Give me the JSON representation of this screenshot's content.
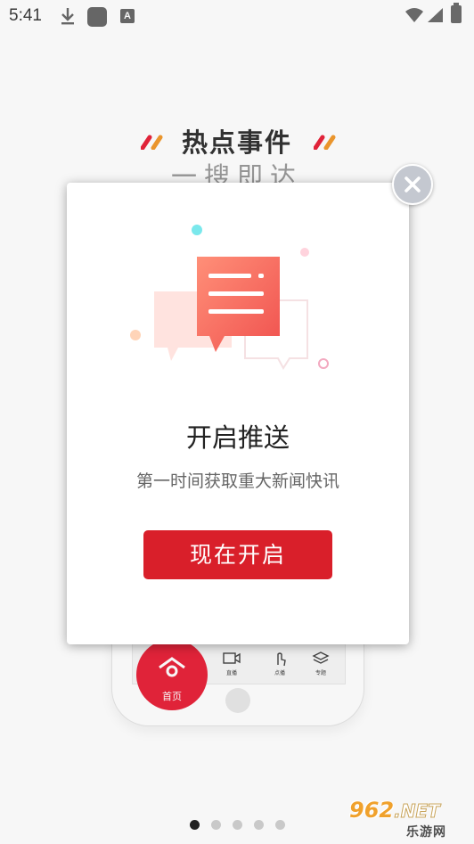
{
  "status_bar": {
    "time": "5:41",
    "icons": [
      "download-icon",
      "app-notification-icon",
      "text-a-icon",
      "wifi-icon",
      "signal-icon",
      "battery-icon"
    ],
    "a_letter": "A"
  },
  "background": {
    "headline": "热点事件",
    "subline": "一搜即达",
    "phone_tabs": {
      "home": "首页",
      "tab2": "直播",
      "tab3": "点播",
      "tab4": "专题"
    }
  },
  "dialog": {
    "title": "开启推送",
    "description": "第一时间获取重大新闻快讯",
    "button_label": "现在开启",
    "close_icon": "close-icon"
  },
  "pager": {
    "count": 5,
    "active_index": 0
  },
  "watermark": {
    "main": "962",
    "suffix": ".NET",
    "sub": "乐游网"
  },
  "colors": {
    "accent": "#d91f2a",
    "home_red": "#e8253b",
    "close_bg": "#c4c8d0"
  }
}
